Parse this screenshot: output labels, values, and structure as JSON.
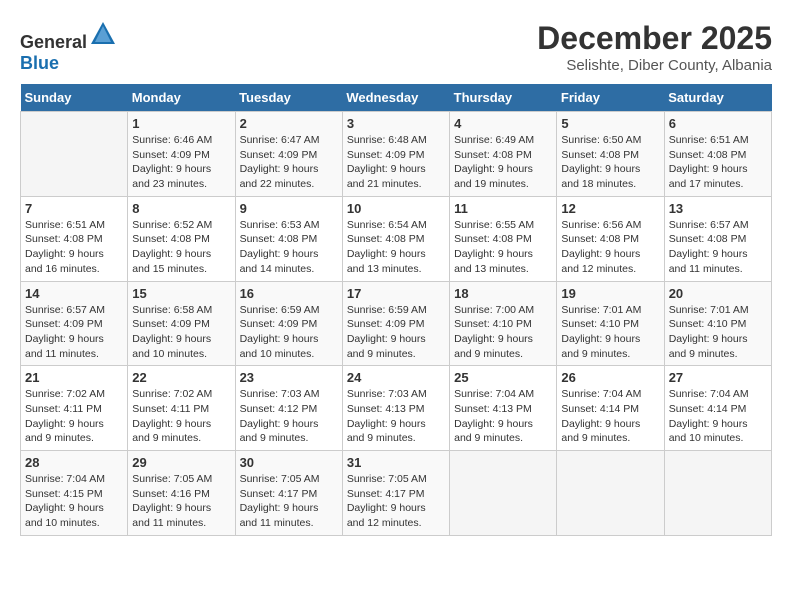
{
  "header": {
    "logo_general": "General",
    "logo_blue": "Blue",
    "month": "December 2025",
    "location": "Selishte, Diber County, Albania"
  },
  "weekdays": [
    "Sunday",
    "Monday",
    "Tuesday",
    "Wednesday",
    "Thursday",
    "Friday",
    "Saturday"
  ],
  "weeks": [
    [
      {
        "day": "",
        "sunrise": "",
        "sunset": "",
        "daylight": ""
      },
      {
        "day": "1",
        "sunrise": "Sunrise: 6:46 AM",
        "sunset": "Sunset: 4:09 PM",
        "daylight": "Daylight: 9 hours and 23 minutes."
      },
      {
        "day": "2",
        "sunrise": "Sunrise: 6:47 AM",
        "sunset": "Sunset: 4:09 PM",
        "daylight": "Daylight: 9 hours and 22 minutes."
      },
      {
        "day": "3",
        "sunrise": "Sunrise: 6:48 AM",
        "sunset": "Sunset: 4:09 PM",
        "daylight": "Daylight: 9 hours and 21 minutes."
      },
      {
        "day": "4",
        "sunrise": "Sunrise: 6:49 AM",
        "sunset": "Sunset: 4:08 PM",
        "daylight": "Daylight: 9 hours and 19 minutes."
      },
      {
        "day": "5",
        "sunrise": "Sunrise: 6:50 AM",
        "sunset": "Sunset: 4:08 PM",
        "daylight": "Daylight: 9 hours and 18 minutes."
      },
      {
        "day": "6",
        "sunrise": "Sunrise: 6:51 AM",
        "sunset": "Sunset: 4:08 PM",
        "daylight": "Daylight: 9 hours and 17 minutes."
      }
    ],
    [
      {
        "day": "7",
        "sunrise": "Sunrise: 6:51 AM",
        "sunset": "Sunset: 4:08 PM",
        "daylight": "Daylight: 9 hours and 16 minutes."
      },
      {
        "day": "8",
        "sunrise": "Sunrise: 6:52 AM",
        "sunset": "Sunset: 4:08 PM",
        "daylight": "Daylight: 9 hours and 15 minutes."
      },
      {
        "day": "9",
        "sunrise": "Sunrise: 6:53 AM",
        "sunset": "Sunset: 4:08 PM",
        "daylight": "Daylight: 9 hours and 14 minutes."
      },
      {
        "day": "10",
        "sunrise": "Sunrise: 6:54 AM",
        "sunset": "Sunset: 4:08 PM",
        "daylight": "Daylight: 9 hours and 13 minutes."
      },
      {
        "day": "11",
        "sunrise": "Sunrise: 6:55 AM",
        "sunset": "Sunset: 4:08 PM",
        "daylight": "Daylight: 9 hours and 13 minutes."
      },
      {
        "day": "12",
        "sunrise": "Sunrise: 6:56 AM",
        "sunset": "Sunset: 4:08 PM",
        "daylight": "Daylight: 9 hours and 12 minutes."
      },
      {
        "day": "13",
        "sunrise": "Sunrise: 6:57 AM",
        "sunset": "Sunset: 4:08 PM",
        "daylight": "Daylight: 9 hours and 11 minutes."
      }
    ],
    [
      {
        "day": "14",
        "sunrise": "Sunrise: 6:57 AM",
        "sunset": "Sunset: 4:09 PM",
        "daylight": "Daylight: 9 hours and 11 minutes."
      },
      {
        "day": "15",
        "sunrise": "Sunrise: 6:58 AM",
        "sunset": "Sunset: 4:09 PM",
        "daylight": "Daylight: 9 hours and 10 minutes."
      },
      {
        "day": "16",
        "sunrise": "Sunrise: 6:59 AM",
        "sunset": "Sunset: 4:09 PM",
        "daylight": "Daylight: 9 hours and 10 minutes."
      },
      {
        "day": "17",
        "sunrise": "Sunrise: 6:59 AM",
        "sunset": "Sunset: 4:09 PM",
        "daylight": "Daylight: 9 hours and 9 minutes."
      },
      {
        "day": "18",
        "sunrise": "Sunrise: 7:00 AM",
        "sunset": "Sunset: 4:10 PM",
        "daylight": "Daylight: 9 hours and 9 minutes."
      },
      {
        "day": "19",
        "sunrise": "Sunrise: 7:01 AM",
        "sunset": "Sunset: 4:10 PM",
        "daylight": "Daylight: 9 hours and 9 minutes."
      },
      {
        "day": "20",
        "sunrise": "Sunrise: 7:01 AM",
        "sunset": "Sunset: 4:10 PM",
        "daylight": "Daylight: 9 hours and 9 minutes."
      }
    ],
    [
      {
        "day": "21",
        "sunrise": "Sunrise: 7:02 AM",
        "sunset": "Sunset: 4:11 PM",
        "daylight": "Daylight: 9 hours and 9 minutes."
      },
      {
        "day": "22",
        "sunrise": "Sunrise: 7:02 AM",
        "sunset": "Sunset: 4:11 PM",
        "daylight": "Daylight: 9 hours and 9 minutes."
      },
      {
        "day": "23",
        "sunrise": "Sunrise: 7:03 AM",
        "sunset": "Sunset: 4:12 PM",
        "daylight": "Daylight: 9 hours and 9 minutes."
      },
      {
        "day": "24",
        "sunrise": "Sunrise: 7:03 AM",
        "sunset": "Sunset: 4:13 PM",
        "daylight": "Daylight: 9 hours and 9 minutes."
      },
      {
        "day": "25",
        "sunrise": "Sunrise: 7:04 AM",
        "sunset": "Sunset: 4:13 PM",
        "daylight": "Daylight: 9 hours and 9 minutes."
      },
      {
        "day": "26",
        "sunrise": "Sunrise: 7:04 AM",
        "sunset": "Sunset: 4:14 PM",
        "daylight": "Daylight: 9 hours and 9 minutes."
      },
      {
        "day": "27",
        "sunrise": "Sunrise: 7:04 AM",
        "sunset": "Sunset: 4:14 PM",
        "daylight": "Daylight: 9 hours and 10 minutes."
      }
    ],
    [
      {
        "day": "28",
        "sunrise": "Sunrise: 7:04 AM",
        "sunset": "Sunset: 4:15 PM",
        "daylight": "Daylight: 9 hours and 10 minutes."
      },
      {
        "day": "29",
        "sunrise": "Sunrise: 7:05 AM",
        "sunset": "Sunset: 4:16 PM",
        "daylight": "Daylight: 9 hours and 11 minutes."
      },
      {
        "day": "30",
        "sunrise": "Sunrise: 7:05 AM",
        "sunset": "Sunset: 4:17 PM",
        "daylight": "Daylight: 9 hours and 11 minutes."
      },
      {
        "day": "31",
        "sunrise": "Sunrise: 7:05 AM",
        "sunset": "Sunset: 4:17 PM",
        "daylight": "Daylight: 9 hours and 12 minutes."
      },
      {
        "day": "",
        "sunrise": "",
        "sunset": "",
        "daylight": ""
      },
      {
        "day": "",
        "sunrise": "",
        "sunset": "",
        "daylight": ""
      },
      {
        "day": "",
        "sunrise": "",
        "sunset": "",
        "daylight": ""
      }
    ]
  ]
}
